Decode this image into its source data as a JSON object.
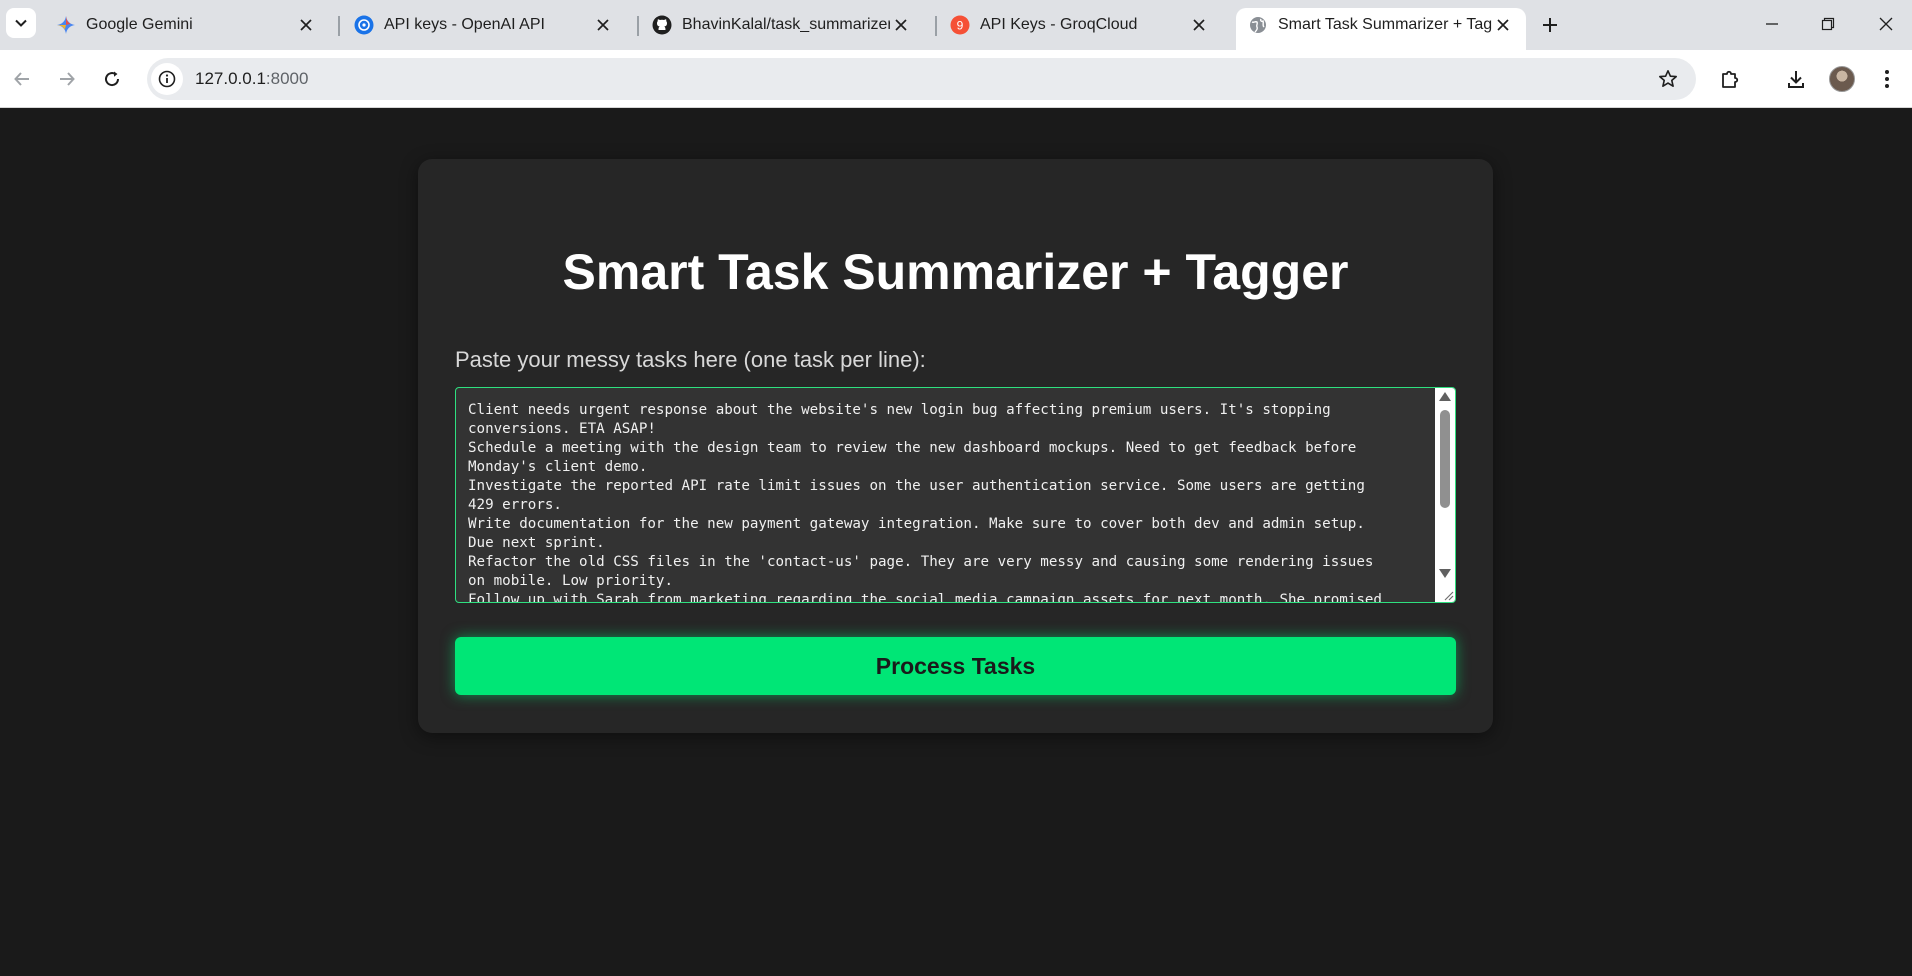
{
  "browser": {
    "tabs": [
      {
        "title": "Google Gemini",
        "icon": "gemini-icon"
      },
      {
        "title": "API keys - OpenAI API",
        "icon": "openai-icon"
      },
      {
        "title": "BhavinKalal/task_summarizer",
        "icon": "github-icon"
      },
      {
        "title": "API Keys - GroqCloud",
        "icon": "groq-icon",
        "badge": "9"
      },
      {
        "title": "Smart Task Summarizer + Tagger",
        "icon": "globe-icon",
        "active": true
      }
    ],
    "url_host": "127.0.0.1",
    "url_port": ":8000"
  },
  "page": {
    "title": "Smart Task Summarizer + Tagger",
    "tasks_label": "Paste your messy tasks here (one task per line):",
    "tasks_lines": [
      "Client needs urgent response about the website's new login bug affecting premium users. It's stopping",
      "conversions. ETA ASAP!",
      "Schedule a meeting with the design team to review the new dashboard mockups. Need to get feedback before",
      "Monday's client demo.",
      "Investigate the reported API rate limit issues on the user authentication service. Some users are getting",
      "429 errors.",
      "Write documentation for the new payment gateway integration. Make sure to cover both dev and admin setup.",
      "Due next sprint.",
      "Refactor the old CSS files in the 'contact-us' page. They are very messy and causing some rendering issues",
      "on mobile. Low priority.",
      "Follow up with Sarah from marketing regarding the social media campaign assets for next month. She promised"
    ],
    "process_button": "Process Tasks"
  },
  "colors": {
    "accent": "#00e676",
    "page_background": "#1a1a1a",
    "card_background": "#262626",
    "textarea_border": "#2ee07f"
  }
}
